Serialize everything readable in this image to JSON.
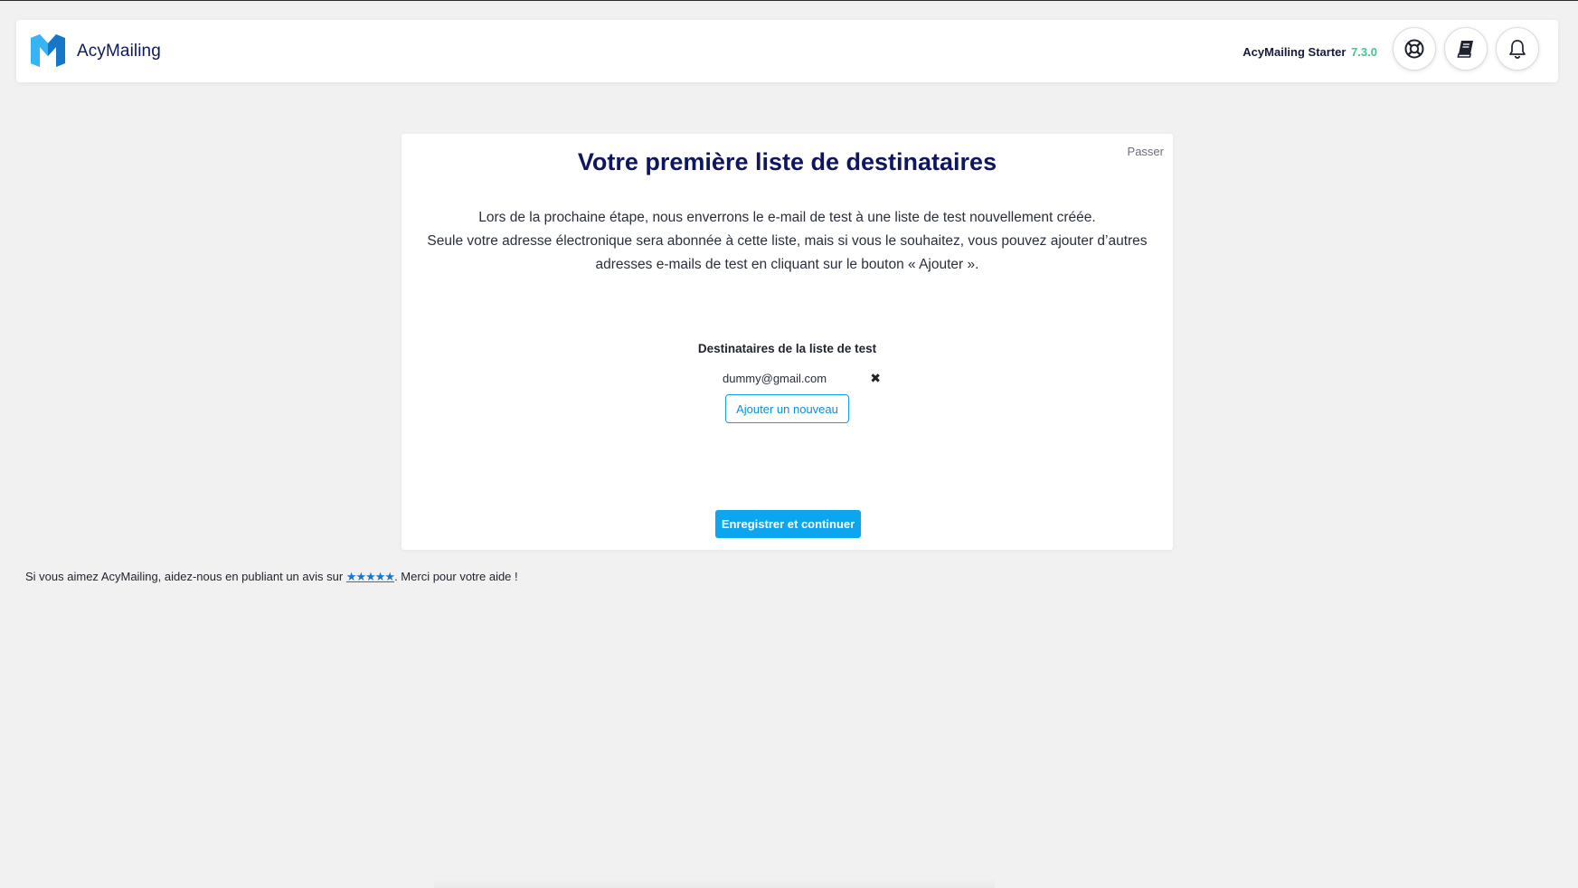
{
  "header": {
    "app_name": "AcyMailing",
    "edition": "AcyMailing Starter",
    "version": "7.3.0",
    "icons": [
      "support-icon",
      "documentation-icon",
      "notification-icon"
    ],
    "accent_color": "#0ba5f0",
    "version_color": "#3ec98a"
  },
  "card": {
    "skip_label": "Passer",
    "title": "Votre première liste de destinataires",
    "description_line1": "Lors de la prochaine étape, nous enverrons le e-mail de test à une liste de test nouvellement créée.",
    "description_line2": "Seule votre adresse électronique sera abonnée à cette liste, mais si vous le souhaitez, vous pouvez ajouter d’autres adresses e-mails de test en cliquant sur le bouton « Ajouter ».",
    "recipients_title": "Destinataires de la liste de test",
    "recipients": [
      "dummy@gmail.com"
    ],
    "remove_symbol": "✖",
    "add_new_label": "Ajouter un nouveau",
    "save_label": "Enregistrer et continuer"
  },
  "footer": {
    "text_before": "Si vous aimez AcyMailing, aidez-nous en publiant un avis sur ",
    "stars": "★★★★★",
    "text_after": ". Merci pour votre aide !"
  }
}
